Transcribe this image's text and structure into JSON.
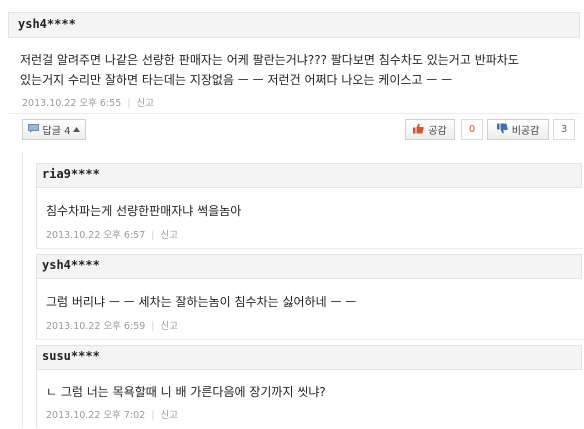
{
  "comment": {
    "user": "ysh4****",
    "line1": "저런걸 알려주면 나같은 선량한 판매자는 어케 팔란는거냐??? 팔다보면 침수차도 있는거고 반파차도",
    "line2": "있는거지 수리만 잘하면 타는데는 지장없음 ㅡ ㅡ 저런건 어쩌다 나오는 케이스고 ㅡ ㅡ",
    "date": "2013.10.22 오후 6:55",
    "report": "신고"
  },
  "actions": {
    "reply_label": "답글 4",
    "like_label": "공감",
    "like_count": "0",
    "dislike_label": "비공감",
    "dislike_count": "3",
    "like_color": "#d9532b",
    "dislike_color": "#3a6fb0"
  },
  "replies": [
    {
      "user": "ria9****",
      "text": "침수차파는게 선량한판매자냐 썩을놈아",
      "date": "2013.10.22 오후 6:57",
      "report": "신고"
    },
    {
      "user": "ysh4****",
      "text": "그럼 버리냐 ㅡ ㅡ 세차는 잘하는놈이 침수차는 싫어하네 ㅡ ㅡ",
      "date": "2013.10.22 오후 6:59",
      "report": "신고"
    },
    {
      "user": "susu****",
      "text": "ㄴ 그럼 너는 목욕할때 니 배 가른다음에 장기까지 씻냐?",
      "date": "2013.10.22 오후 7:02",
      "report": "신고"
    }
  ]
}
